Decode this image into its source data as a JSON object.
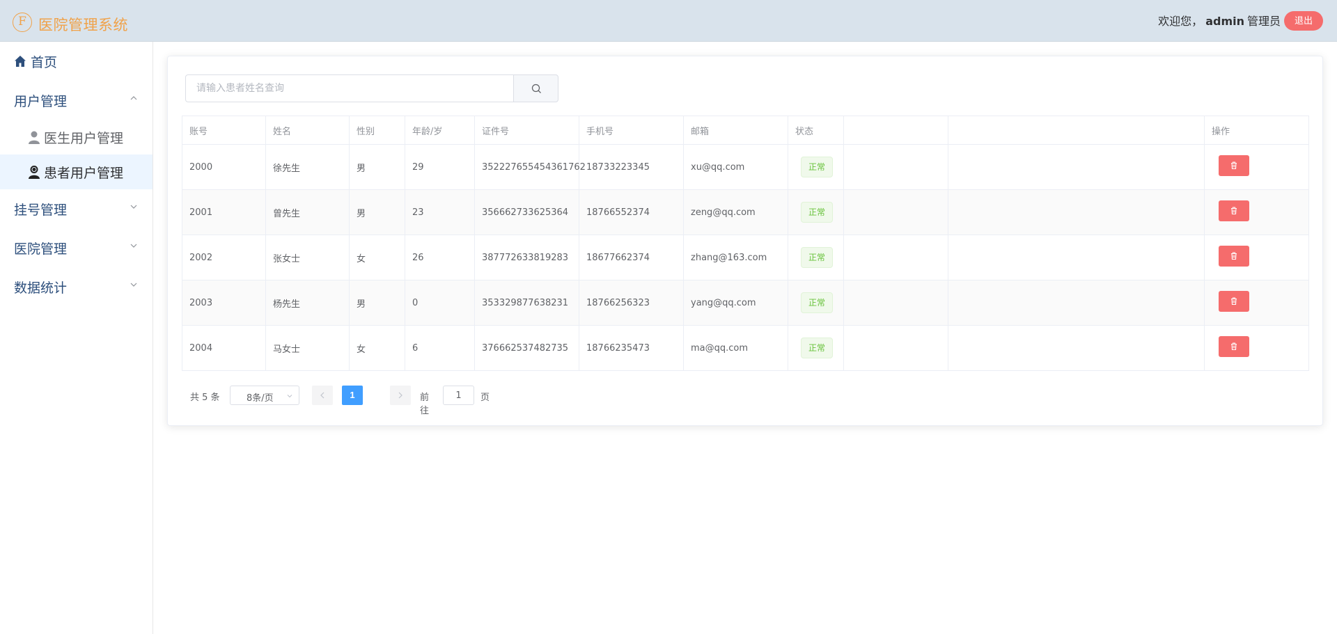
{
  "header": {
    "logo_letter": "F",
    "app_title": "医院管理系统",
    "welcome_prefix": "欢迎您，",
    "username": "admin",
    "role": "管理员",
    "logout_label": "退出"
  },
  "sidebar": {
    "home": "首页",
    "user_mgmt": "用户管理",
    "doctor_users": "医生用户管理",
    "patient_users": "患者用户管理",
    "registration_mgmt": "挂号管理",
    "hospital_mgmt": "医院管理",
    "data_stats": "数据统计"
  },
  "search": {
    "placeholder": "请输入患者姓名查询"
  },
  "table": {
    "headers": {
      "account": "账号",
      "name": "姓名",
      "gender": "性别",
      "age": "年龄/岁",
      "id_number": "证件号",
      "phone": "手机号",
      "email": "邮箱",
      "status": "状态",
      "actions": "操作"
    },
    "rows": [
      {
        "account": "2000",
        "name": "徐先生",
        "gender": "男",
        "age": "29",
        "id_number": "352227655454361762",
        "phone": "18733223345",
        "email": "xu@qq.com",
        "status": "正常"
      },
      {
        "account": "2001",
        "name": "曾先生",
        "gender": "男",
        "age": "23",
        "id_number": "356662733625364",
        "phone": "18766552374",
        "email": "zeng@qq.com",
        "status": "正常"
      },
      {
        "account": "2002",
        "name": "张女士",
        "gender": "女",
        "age": "26",
        "id_number": "387772633819283",
        "phone": "18677662374",
        "email": "zhang@163.com",
        "status": "正常"
      },
      {
        "account": "2003",
        "name": "杨先生",
        "gender": "男",
        "age": "0",
        "id_number": "353329877638231",
        "phone": "18766256323",
        "email": "yang@qq.com",
        "status": "正常"
      },
      {
        "account": "2004",
        "name": "马女士",
        "gender": "女",
        "age": "6",
        "id_number": "376662537482735",
        "phone": "18766235473",
        "email": "ma@qq.com",
        "status": "正常"
      }
    ]
  },
  "pagination": {
    "total_text": "共 5 条",
    "page_size": "8条/页",
    "current_page": "1",
    "goto_label": "前往",
    "goto_value": "1",
    "page_suffix": "页"
  },
  "colors": {
    "header_bg": "#d9e3ec",
    "brand": "#f0a24a",
    "danger": "#f56c6c",
    "primary": "#409eff",
    "success": "#67c23a",
    "menu_text": "#2d4f7c"
  }
}
